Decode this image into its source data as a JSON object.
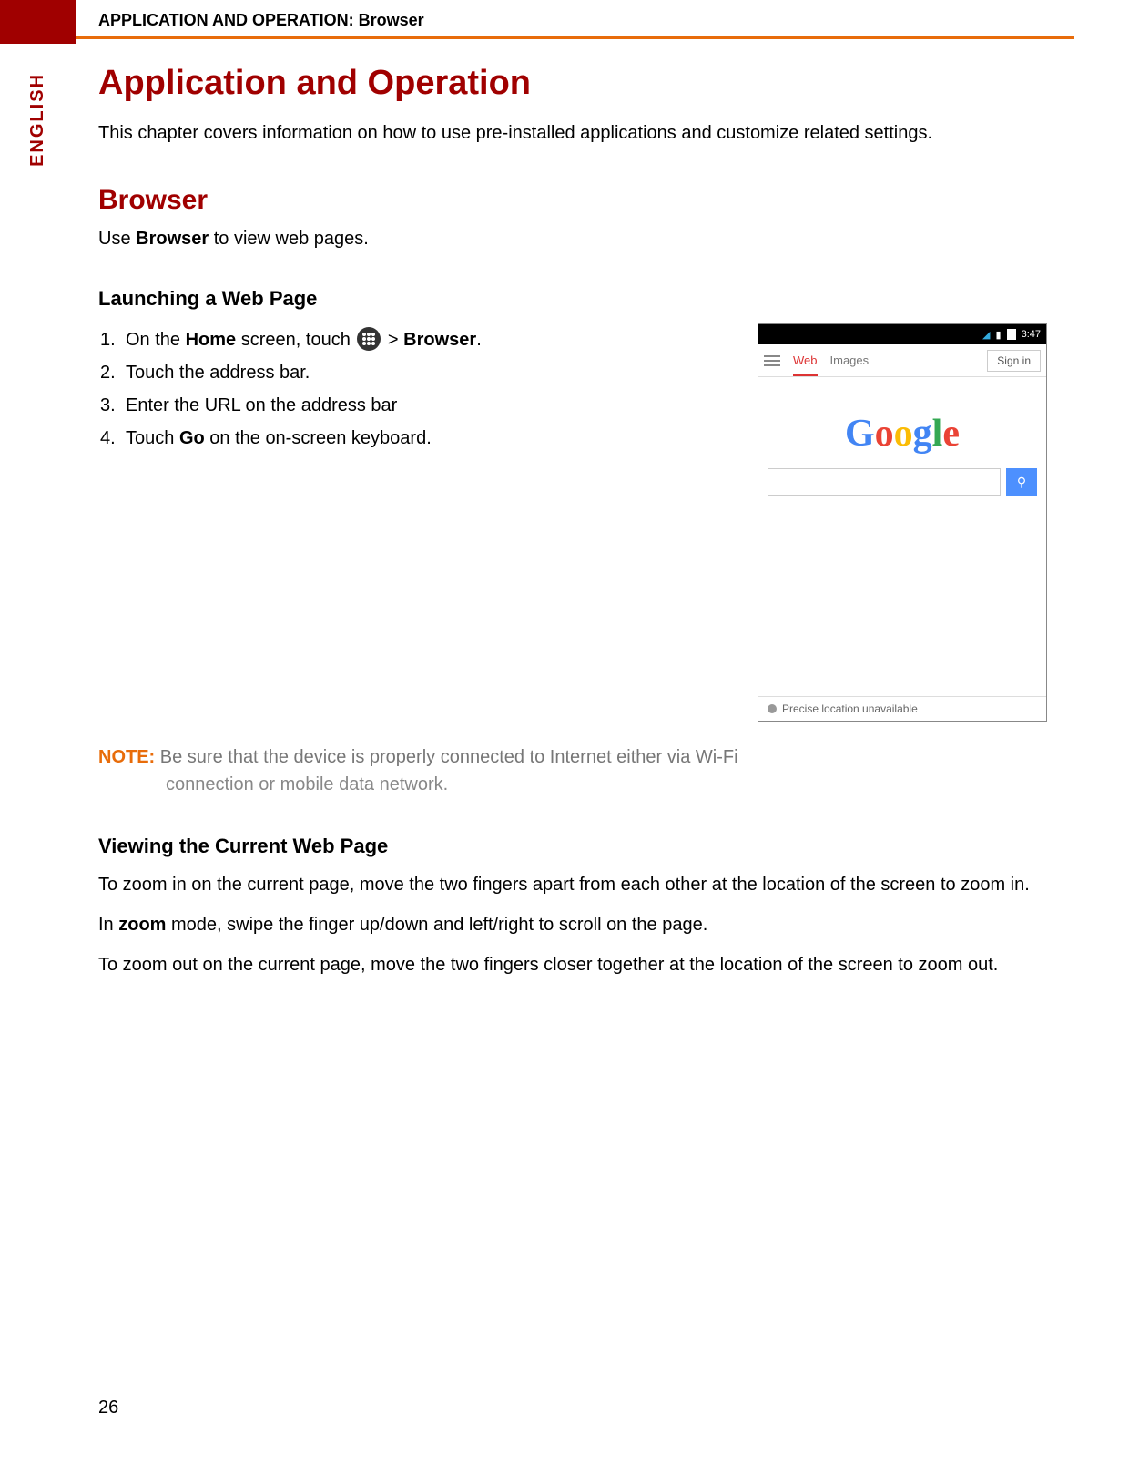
{
  "header": {
    "running_head": "APPLICATION AND OPERATION: Browser",
    "side_tab": "ENGLISH"
  },
  "title": "Application and Operation",
  "intro": "This chapter covers information on how to use pre-installed applications and customize related settings.",
  "browser": {
    "heading": "Browser",
    "use_prefix": "Use ",
    "use_bold": "Browser",
    "use_suffix": " to view web pages."
  },
  "launch": {
    "heading": "Launching a Web Page",
    "steps": {
      "s1_prefix": "On the ",
      "s1_home": "Home",
      "s1_mid": " screen, touch ",
      "s1_gt": " > ",
      "s1_browser": "Browser",
      "s1_end": ".",
      "s2": "Touch the address bar.",
      "s3": "Enter the URL on the address bar",
      "s4_prefix": "Touch ",
      "s4_go": "Go",
      "s4_suffix": " on the on-screen keyboard."
    },
    "nums": {
      "n1": "1.",
      "n2": "2.",
      "n3": "3.",
      "n4": "4."
    }
  },
  "phone": {
    "time": "3:47",
    "tab_web": "Web",
    "tab_images": "Images",
    "sign_in": "Sign in",
    "logo": {
      "c1": "G",
      "c2": "o",
      "c3": "o",
      "c4": "g",
      "c5": "l",
      "c6": "e"
    },
    "search_icon": "⚲",
    "footer": "Precise location unavailable"
  },
  "note": {
    "label": "NOTE:",
    "line1": " Be sure that the device is properly connected to Internet either via Wi-Fi",
    "line2": "connection or mobile data network."
  },
  "viewing": {
    "heading": "Viewing the Current Web Page",
    "p1": "To zoom in on the current page, move the two fingers apart from each other at the location of the screen to zoom in.",
    "p2_prefix": "In ",
    "p2_zoom": "zoom",
    "p2_suffix": " mode, swipe the finger up/down and left/right to scroll on the page.",
    "p3": "To zoom out on the current page, move the two fingers closer together at the location of the screen to zoom out."
  },
  "page_number": "26"
}
